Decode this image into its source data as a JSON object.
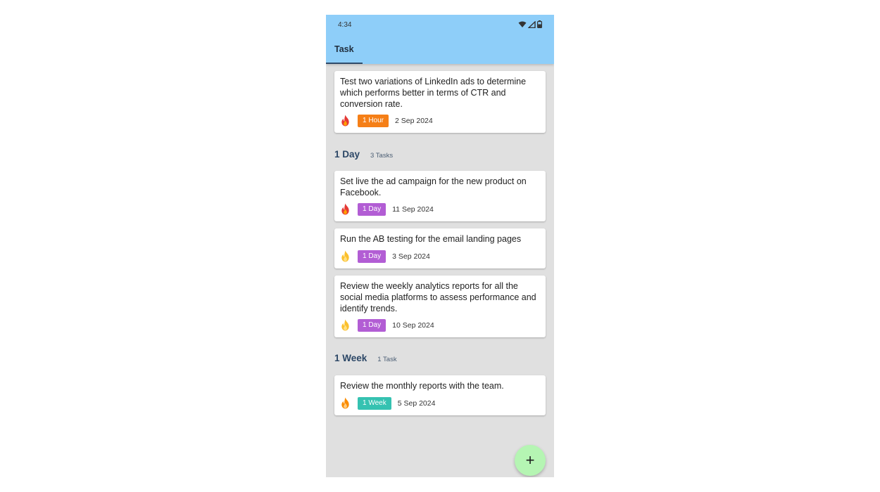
{
  "status_bar": {
    "time": "4:34",
    "icons": [
      "wifi-icon",
      "signal-icon",
      "battery-icon"
    ]
  },
  "tabs": [
    {
      "label": "Task",
      "selected": true
    }
  ],
  "tasks": [
    {
      "text": "Test two variations of LinkedIn ads to determine which performs better in terms of CTR and conversion rate.",
      "priority": "high",
      "chip": "1 Hour",
      "date": "2 Sep 2024"
    },
    {
      "text": "Set live the ad campaign for the new product on Facebook.",
      "priority": "high",
      "chip": "1 Day",
      "date": "11 Sep 2024"
    },
    {
      "text": "Run the AB testing for the email landing pages",
      "priority": "low",
      "chip": "1 Day",
      "date": "3 Sep 2024"
    },
    {
      "text": "Review the weekly analytics reports for all the social media platforms to assess performance and identify trends.",
      "priority": "low",
      "chip": "1 Day",
      "date": "10 Sep 2024"
    },
    {
      "text": "Review the monthly reports with the team.",
      "priority": "medium",
      "chip": "1 Week",
      "date": "5 Sep 2024"
    }
  ],
  "sections": {
    "day": {
      "title": "1 Day",
      "count": "3 Tasks"
    },
    "week": {
      "title": "1 Week",
      "count": "1 Task"
    }
  },
  "fab": {
    "label": "+",
    "icon": "plus-icon"
  },
  "colors": {
    "app_bar": "#8ecef9",
    "background": "#e0e0e0",
    "chip_hour": "#f57f17",
    "chip_day": "#b25dd4",
    "chip_week": "#35c2b1",
    "fab": "#b5f5b3",
    "flame_high": "#e53935",
    "flame_medium": "#fb8c00",
    "flame_low": "#fbc02d"
  }
}
